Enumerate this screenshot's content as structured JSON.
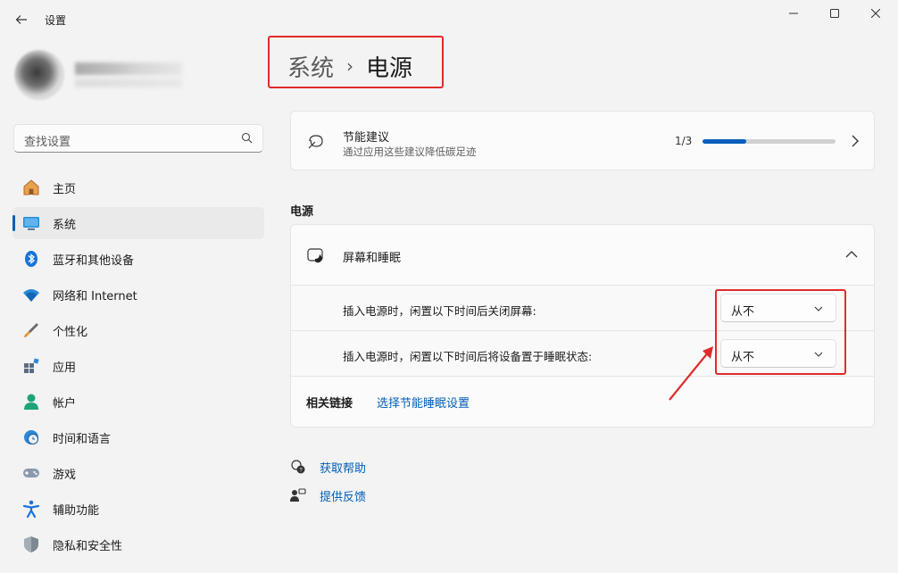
{
  "window": {
    "title": "设置"
  },
  "search": {
    "placeholder": "查找设置"
  },
  "sidebar": {
    "items": [
      {
        "label": "主页",
        "icon": "home-icon"
      },
      {
        "label": "系统",
        "icon": "system-display-icon",
        "active": true
      },
      {
        "label": "蓝牙和其他设备",
        "icon": "bluetooth-icon"
      },
      {
        "label": "网络和 Internet",
        "icon": "wifi-icon"
      },
      {
        "label": "个性化",
        "icon": "brush-icon"
      },
      {
        "label": "应用",
        "icon": "apps-icon"
      },
      {
        "label": "帐户",
        "icon": "account-icon"
      },
      {
        "label": "时间和语言",
        "icon": "clock-globe-icon"
      },
      {
        "label": "游戏",
        "icon": "gamepad-icon"
      },
      {
        "label": "辅助功能",
        "icon": "accessibility-icon"
      },
      {
        "label": "隐私和安全性",
        "icon": "shield-icon"
      }
    ]
  },
  "breadcrumb": {
    "parent": "系统",
    "separator": "›",
    "current": "电源"
  },
  "energy_card": {
    "title": "节能建议",
    "subtitle": "通过应用这些建议降低碳足迹",
    "count": "1/3",
    "progress": 0.33
  },
  "power_section": {
    "title": "电源",
    "group_title": "屏幕和睡眠",
    "rows": [
      {
        "label": "插入电源时，闲置以下时间后关闭屏幕:",
        "value": "从不"
      },
      {
        "label": "插入电源时，闲置以下时间后将设备置于睡眠状态:",
        "value": "从不"
      }
    ],
    "related_label": "相关链接",
    "related_link": "选择节能睡眠设置"
  },
  "help": {
    "get_help": "获取帮助",
    "feedback": "提供反馈"
  },
  "colors": {
    "accent": "#005fb8",
    "annotation_red": "#e02b2b"
  }
}
